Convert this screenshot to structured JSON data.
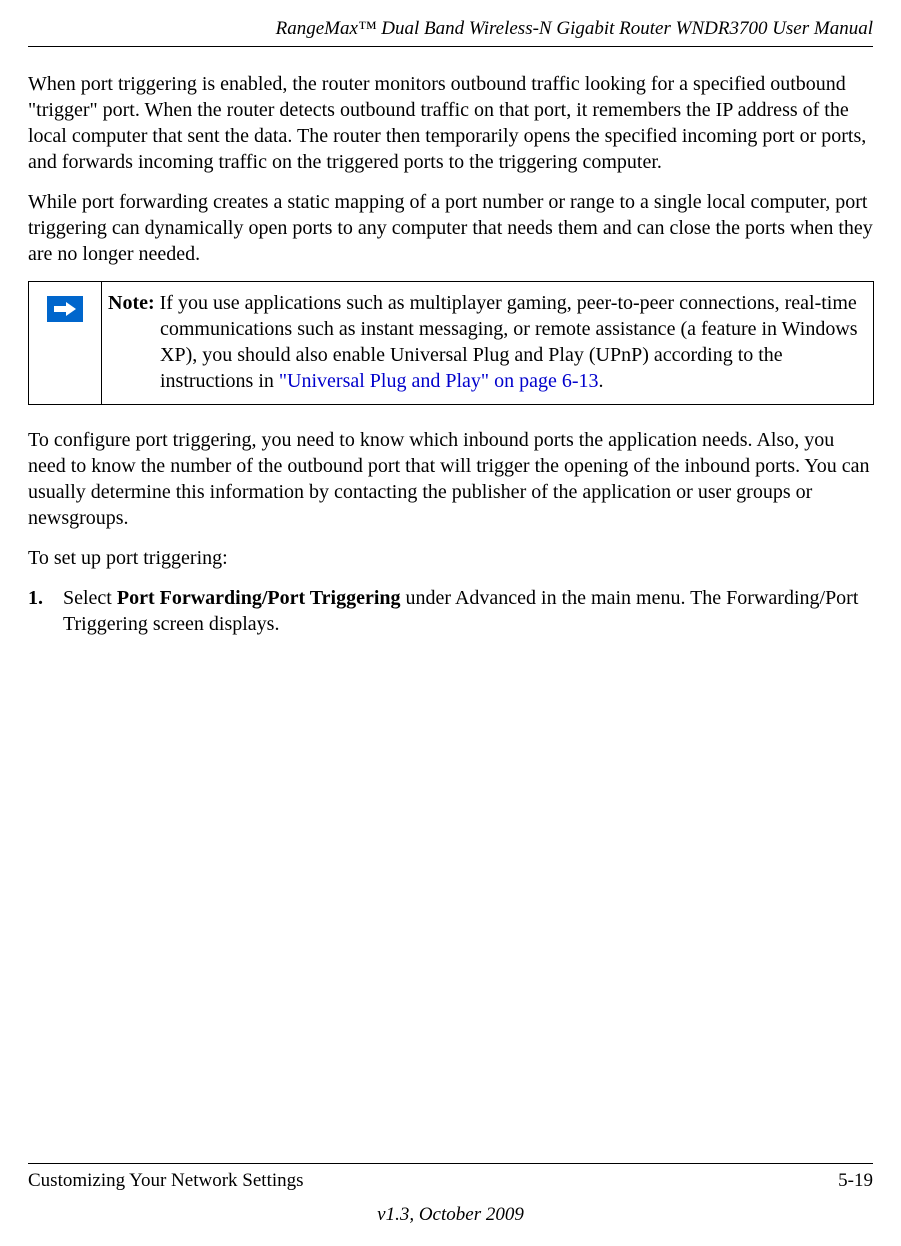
{
  "header": {
    "title": "RangeMax™ Dual Band Wireless-N Gigabit Router WNDR3700 User Manual"
  },
  "paragraphs": {
    "p1": "When port triggering is enabled, the router monitors outbound traffic looking for a specified outbound \"trigger\" port. When the router detects outbound traffic on that port, it remembers the IP address of the local computer that sent the data. The router then temporarily opens the specified incoming port or ports, and forwards incoming traffic on the triggered ports to the triggering computer.",
    "p2": "While port forwarding creates a static mapping of a port number or range to a single local computer, port triggering can dynamically open ports to any computer that needs them and can close the ports when they are no longer needed.",
    "p3": "To configure port triggering, you need to know which inbound ports the application needs. Also, you need to know the number of the outbound port that will trigger the opening of the inbound ports. You can usually determine this information by contacting the publisher of the application or user groups or newsgroups.",
    "p4": "To set up port triggering:"
  },
  "note": {
    "label": "Note:",
    "text_before_link": " If you use applications such as multiplayer gaming, peer-to-peer connections, real-time communications such as instant messaging, or remote assistance (a feature in Windows XP), you should also enable Universal Plug and Play (UPnP) according to the instructions in ",
    "link": "\"Universal Plug and Play\" on page 6-13",
    "text_after_link": "."
  },
  "steps": {
    "s1": {
      "number": "1.",
      "text_before_bold": "Select ",
      "bold": "Port Forwarding/Port Triggering",
      "text_after_bold": " under Advanced in the main menu. The Forwarding/Port Triggering screen displays."
    }
  },
  "footer": {
    "left": "Customizing Your Network Settings",
    "right": "5-19",
    "version": "v1.3, October 2009"
  }
}
